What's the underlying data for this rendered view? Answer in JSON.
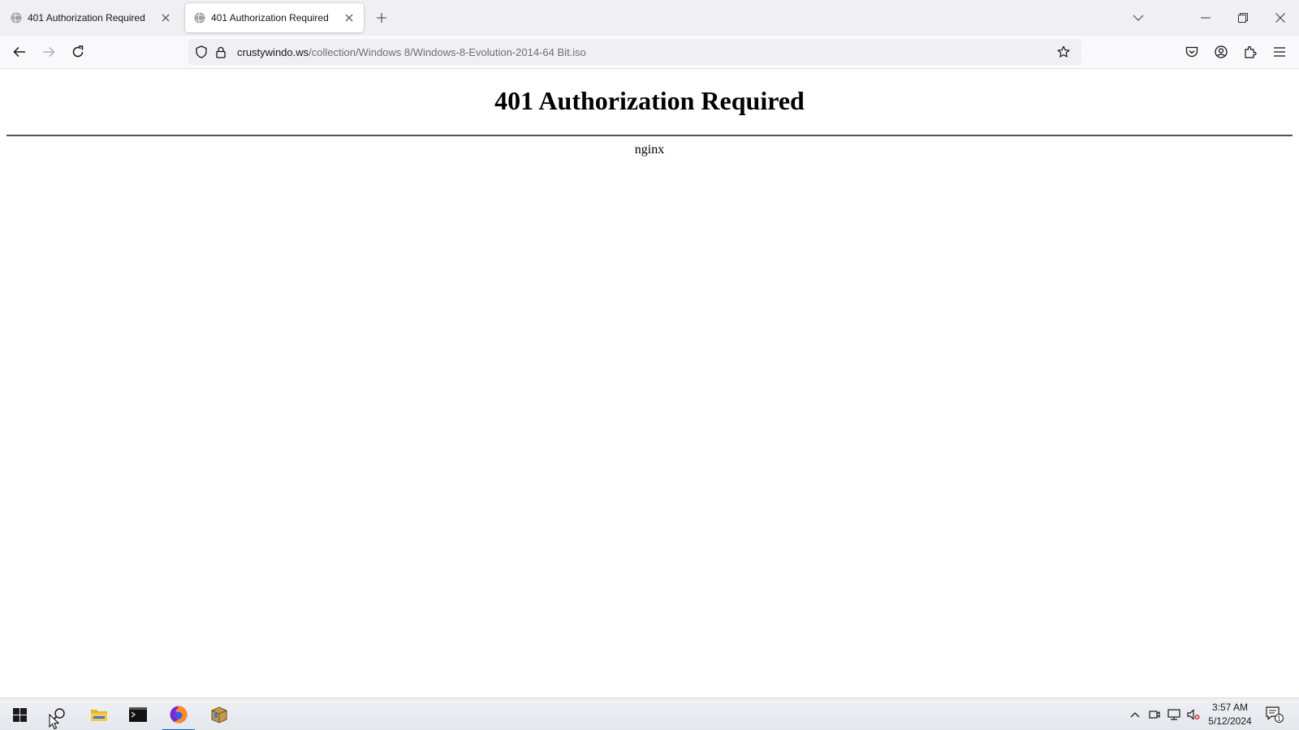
{
  "browser": {
    "tabs": [
      {
        "title": "401 Authorization Required",
        "active": false
      },
      {
        "title": "401 Authorization Required",
        "active": true
      }
    ],
    "url": {
      "domain": "crustywindo.ws",
      "path": "/collection/Windows 8/Windows-8-Evolution-2014-64 Bit.iso"
    }
  },
  "page": {
    "heading": "401 Authorization Required",
    "server": "nginx"
  },
  "taskbar": {
    "clock_time": "3:57 AM",
    "clock_date": "5/12/2024",
    "notification_count": "1"
  },
  "colors": {
    "accent": "#0067c0",
    "tab_strip": "#f0f0f4",
    "urlbar": "#f0f0f4"
  }
}
